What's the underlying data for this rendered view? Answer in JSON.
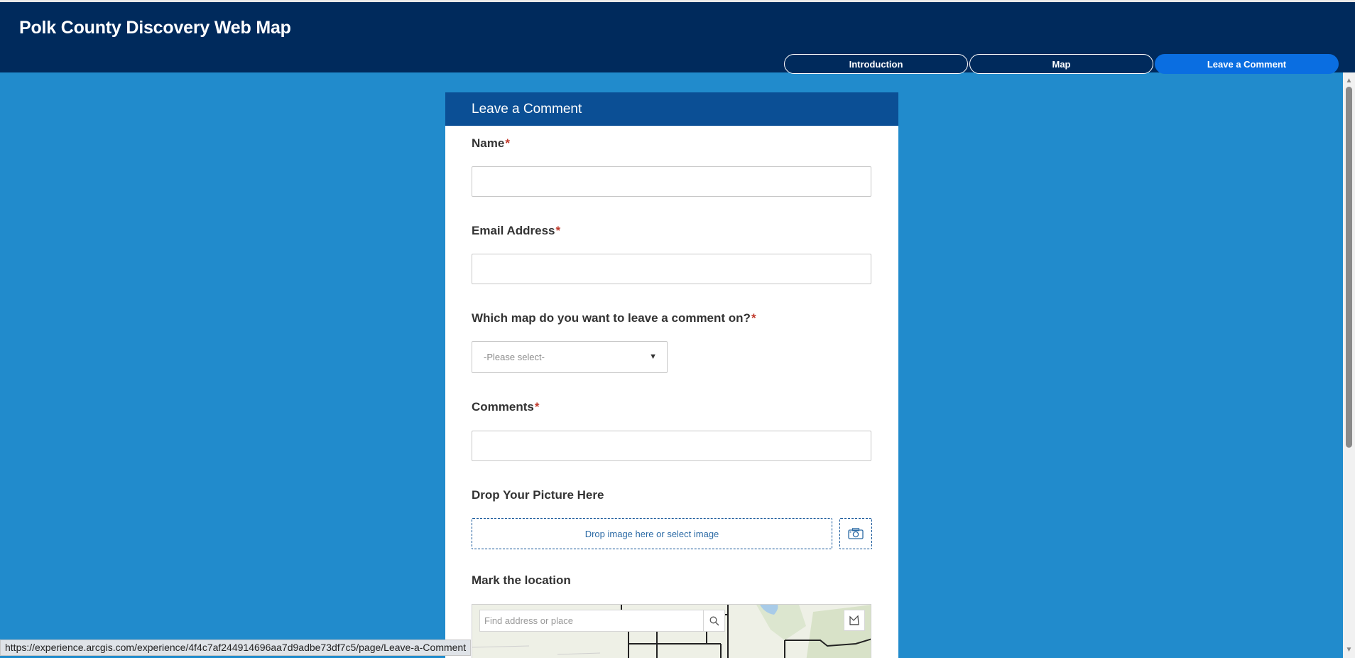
{
  "header": {
    "title": "Polk County Discovery Web Map",
    "tabs": [
      {
        "label": "Introduction",
        "active": false
      },
      {
        "label": "Map",
        "active": false
      },
      {
        "label": "Leave a Comment",
        "active": true
      }
    ]
  },
  "form": {
    "title": "Leave a Comment",
    "name": {
      "label": "Name",
      "required_mark": "*",
      "value": ""
    },
    "email": {
      "label": "Email Address",
      "required_mark": "*",
      "value": ""
    },
    "map_select": {
      "label": "Which map do you want to leave a comment on?",
      "required_mark": "*",
      "selected": "-Please select-"
    },
    "comments": {
      "label": "Comments",
      "required_mark": "*",
      "value": ""
    },
    "picture": {
      "label": "Drop Your Picture Here",
      "dropzone_text": "Drop image here or select image",
      "button_icon": "camera-icon"
    },
    "location": {
      "label": "Mark the location",
      "search_placeholder": "Find address or place",
      "search_icon": "search-icon",
      "tool_icon": "select-area-icon"
    }
  },
  "status_bar": {
    "url": "https://experience.arcgis.com/experience/4f4c7af244914696aa7d9adbe73df7c5/page/Leave-a-Comment"
  },
  "colors": {
    "header_bg": "#002a5c",
    "page_bg": "#218bcc",
    "card_header_bg": "#0b4f95",
    "active_tab": "#0a6ee1",
    "required": "#c0392b"
  }
}
